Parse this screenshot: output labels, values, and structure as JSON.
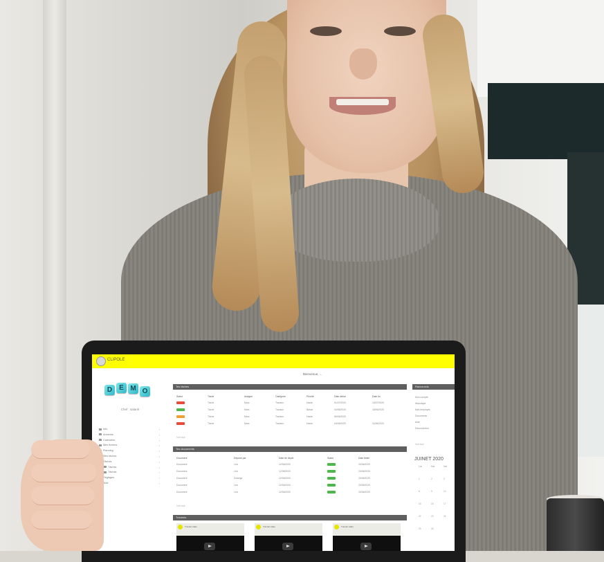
{
  "app": {
    "name": "CLIPOLE",
    "welcome": "Bienvenue, ..."
  },
  "brand": {
    "accent": "#ffff00",
    "panel_header": "#5f5f5f",
    "badge_red": "#e74c3c",
    "badge_green": "#4cb84c",
    "badge_orange": "#f0a030"
  },
  "sidebar": {
    "demo_letters": [
      "D",
      "E",
      "M",
      "O"
    ],
    "user_name": "Chef : salarié",
    "user_sub": "...",
    "items": [
      {
        "label": "Info"
      },
      {
        "label": "Annexes"
      },
      {
        "label": "Calendrier"
      },
      {
        "label": "Mes fichiers"
      },
      {
        "label": "Planning"
      },
      {
        "label": "Mes tâches"
      },
      {
        "label": "Tâches"
      },
      {
        "label": "Tâches",
        "sub": true
      },
      {
        "label": "Tâches",
        "sub": true
      },
      {
        "label": "Réglages"
      },
      {
        "label": "Aide"
      }
    ]
  },
  "tasks_panel": {
    "title": "Tes tâches",
    "columns": [
      "Statut",
      "Tâche",
      "Assigné",
      "Catégorie",
      "Priorité",
      "Date début",
      "Date fin"
    ],
    "rows": [
      {
        "badge": "red",
        "cells": [
          "Tâche",
          "Marc",
          "Travaux",
          "Haute",
          "01/07/2020",
          "15/07/2020"
        ]
      },
      {
        "badge": "green",
        "cells": [
          "Tâche",
          "Marc",
          "Travaux",
          "Basse",
          "04/06/2020",
          "18/06/2020"
        ]
      },
      {
        "badge": "orange",
        "cells": [
          "Tâche",
          "Marc",
          "Travaux",
          "Haute",
          "06/06/2020",
          ""
        ]
      },
      {
        "badge": "red",
        "cells": [
          "Tâche",
          "Marc",
          "Travaux",
          "Haute",
          "04/06/2020",
          "11/06/2020"
        ]
      }
    ],
    "more": "Voir tout"
  },
  "documents_panel": {
    "title": "Tes documents",
    "columns": [
      "Document",
      "Déposé par",
      "Date de dépôt",
      "Statut",
      "Date limite"
    ],
    "rows": [
      {
        "badge": "green",
        "cells": [
          "Document",
          "Léa",
          "12/06/2020",
          "20/06/2020"
        ]
      },
      {
        "badge": "green",
        "cells": [
          "Document",
          "Léa",
          "12/06/2020",
          "20/06/2020"
        ]
      },
      {
        "badge": "green",
        "cells": [
          "Document",
          "Solange",
          "12/06/2020",
          "20/06/2020"
        ]
      },
      {
        "badge": "green",
        "cells": [
          "Document",
          "Léa",
          "12/06/2020",
          "20/06/2020"
        ]
      },
      {
        "badge": "green",
        "cells": [
          "Document",
          "Léa",
          "12/06/2020",
          "20/06/2020"
        ]
      }
    ],
    "more": "Voir tout"
  },
  "videos_panel": {
    "title": "Tutoriels",
    "items": [
      {
        "title": "Tutoriel vidéo"
      },
      {
        "title": "Tutoriel vidéo"
      },
      {
        "title": "Tutoriel vidéo"
      }
    ]
  },
  "right_panel": {
    "title": "Raccourcis",
    "links": [
      "Mon compte",
      "Historique",
      "Mes employés",
      "Documents",
      "Aide",
      "Déconnexion"
    ],
    "more": "Voir tout",
    "calendar_title": "JUINET 2020",
    "calendar_cells": [
      "Lun",
      "Mar",
      "Mer",
      "1",
      "2",
      "3",
      "8",
      "9",
      "10",
      "15",
      "16",
      "17",
      "22",
      "23",
      "24",
      "29",
      "30"
    ]
  }
}
